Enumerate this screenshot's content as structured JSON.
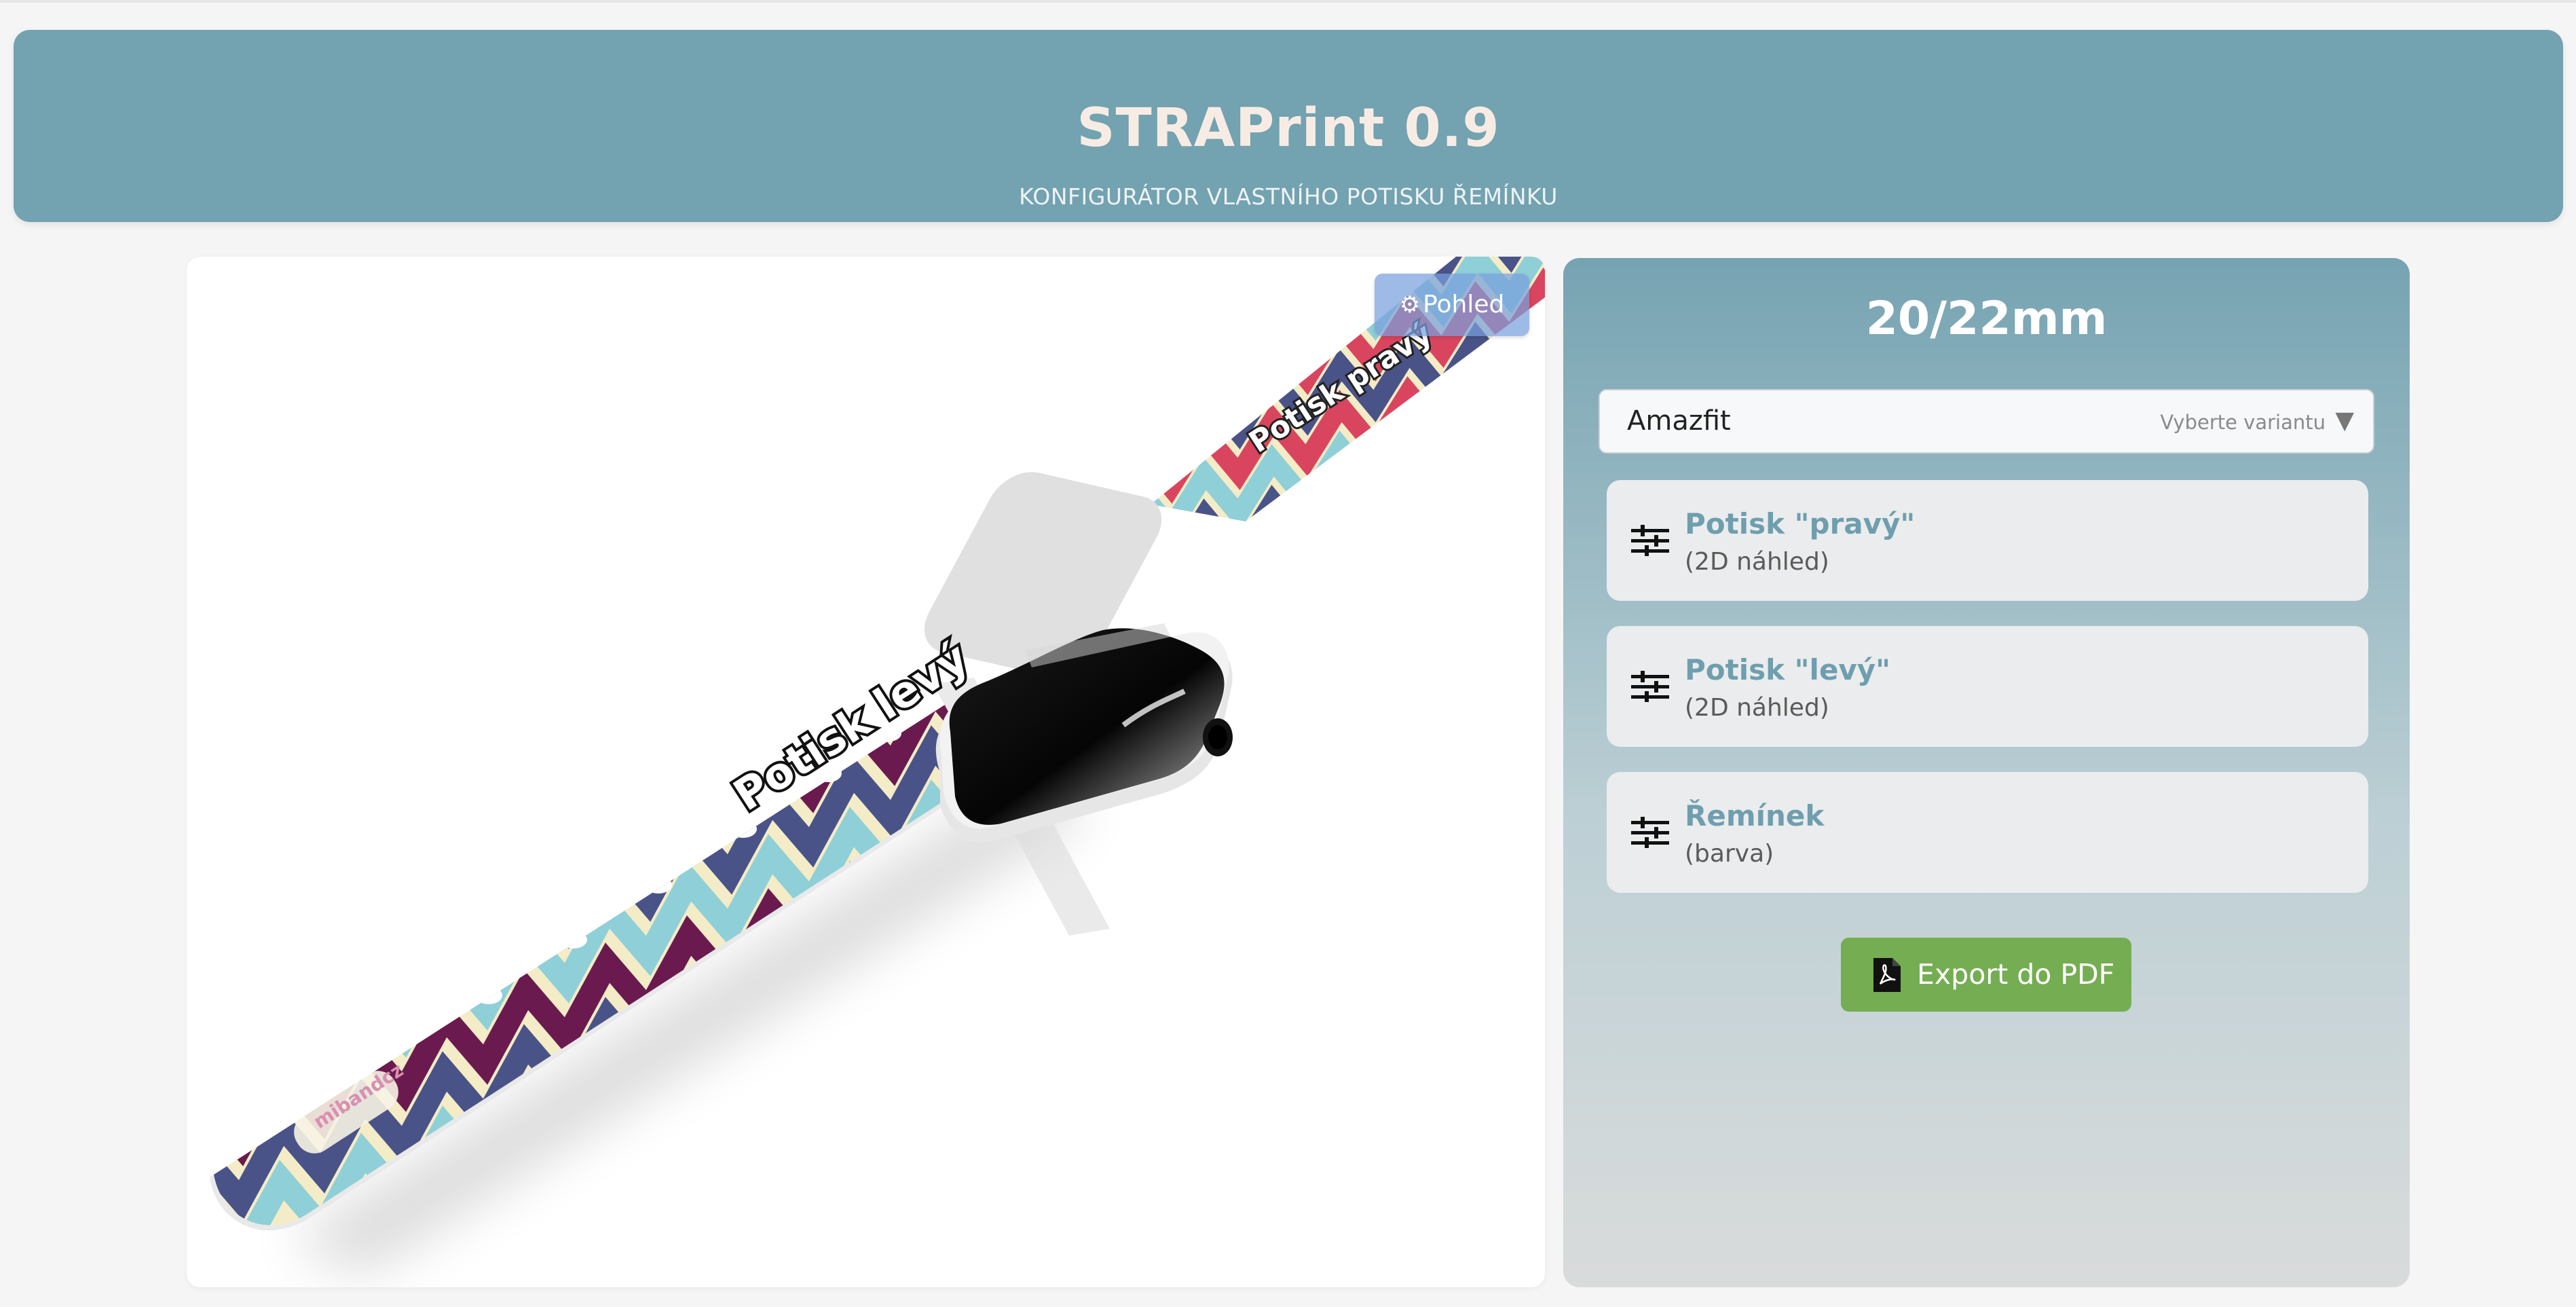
{
  "header": {
    "title": "STRAPrint 0.9",
    "subtitle": "KONFIGURÁTOR VLASTNÍHO POTISKU ŘEMÍNKU"
  },
  "preview": {
    "view_button": "Pohled",
    "strap_label_left": "Potisk levý",
    "strap_label_right": "Potisk pravý",
    "brand_logo_text": "mibandcz",
    "pattern_colors": [
      "#f3ecc6",
      "#8fcfd8",
      "#6a1a4f",
      "#4a5388",
      "#d9455f"
    ]
  },
  "panel": {
    "size_label": "20/22mm",
    "brand_select": {
      "value": "Amazfit",
      "hint": "Vyberte variantu"
    },
    "options": [
      {
        "title": "Potisk \"pravý\"",
        "subtitle": "(2D náhled)",
        "icon": "sliders-icon"
      },
      {
        "title": "Potisk \"levý\"",
        "subtitle": "(2D náhled)",
        "icon": "sliders-icon"
      },
      {
        "title": "Řemínek",
        "subtitle": "(barva)",
        "icon": "sliders-icon"
      }
    ],
    "export_button": "Export do PDF"
  }
}
